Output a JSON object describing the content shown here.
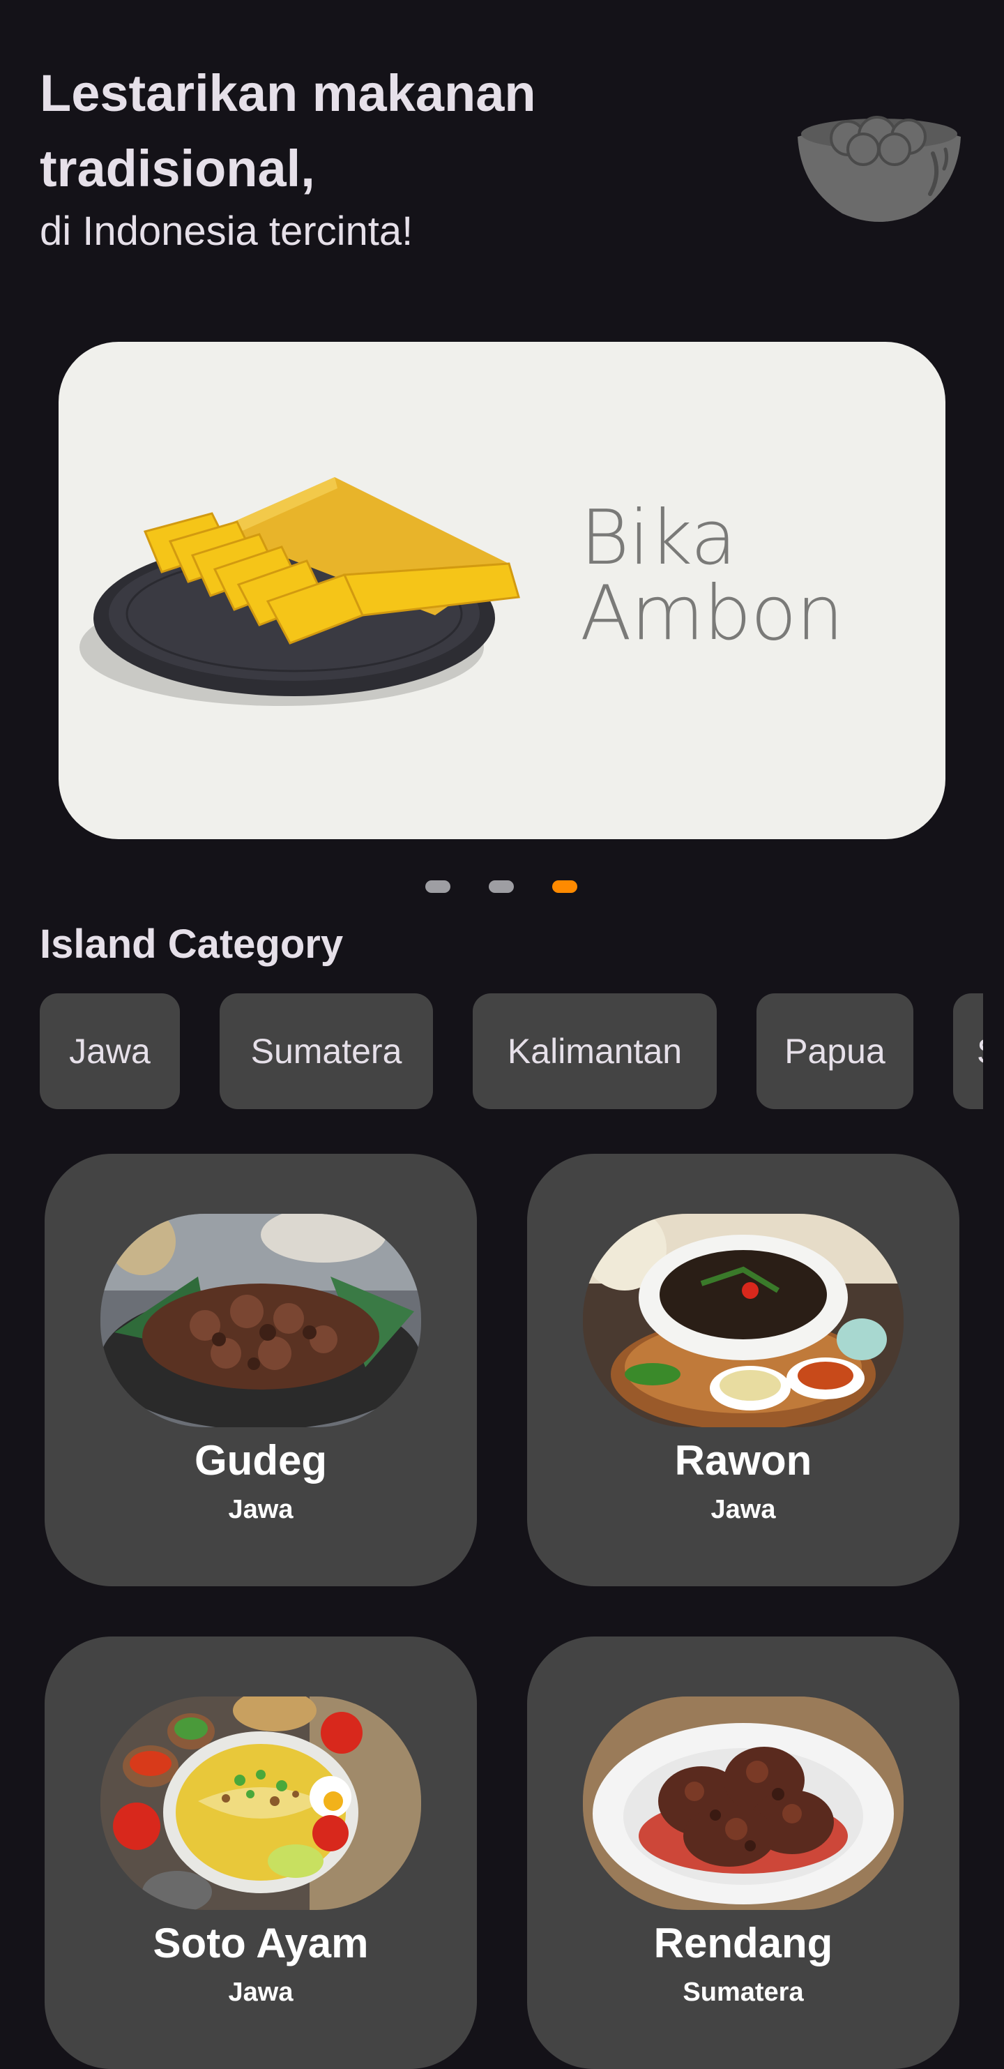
{
  "header": {
    "headline": "Lestarikan makanan tradisional,",
    "subtitle": "di Indonesia tercinta!",
    "icon": "bowl-icon"
  },
  "carousel": {
    "banner_title_line1": "Bika",
    "banner_title_line2": "Ambon",
    "slide_count": 3,
    "active_index": 2,
    "active_color": "#ff8a00"
  },
  "categories": {
    "title": "Island Category",
    "chips": [
      "Jawa",
      "Sumatera",
      "Kalimantan",
      "Papua",
      "S"
    ]
  },
  "foods": [
    {
      "name": "Gudeg",
      "region": "Jawa"
    },
    {
      "name": "Rawon",
      "region": "Jawa"
    },
    {
      "name": "Soto Ayam",
      "region": "Jawa"
    },
    {
      "name": "Rendang",
      "region": "Sumatera"
    }
  ],
  "colors": {
    "background": "#141218",
    "surface": "#444444",
    "banner": "#f0f0ec",
    "accent": "#ff8a00"
  }
}
